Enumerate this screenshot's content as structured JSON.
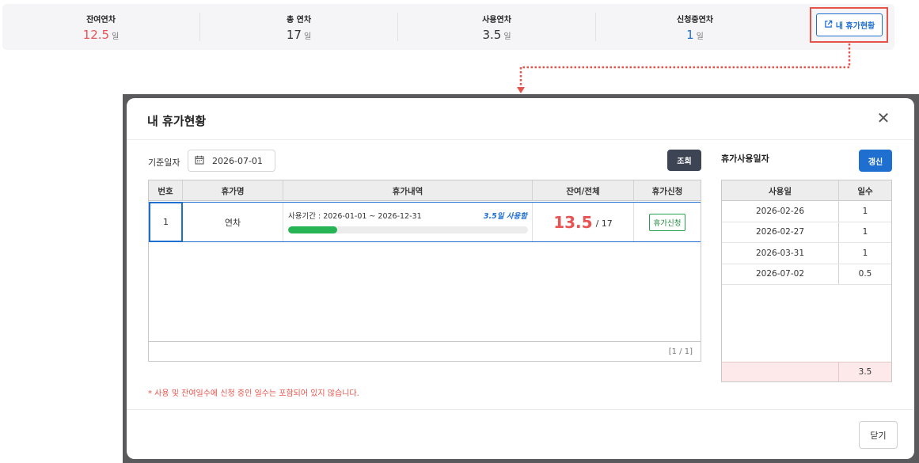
{
  "summary": {
    "remaining": {
      "label": "잔여연차",
      "value": "12.5",
      "unit": "일"
    },
    "total": {
      "label": "총 연차",
      "value": "17",
      "unit": "일"
    },
    "used": {
      "label": "사용연차",
      "value": "3.5",
      "unit": "일"
    },
    "pending": {
      "label": "신청중연차",
      "value": "1",
      "unit": "일"
    },
    "my_leave_button": "내 휴가현황"
  },
  "colors": {
    "accent": "#1f6fd1",
    "highlight": "#e5534b",
    "remaining": "#e85454",
    "progress": "#27b455"
  },
  "modal": {
    "title": "내 휴가현황",
    "base_date_label": "기준일자",
    "base_date_value": "2026-07-01",
    "search_button": "조회",
    "table": {
      "headers": [
        "번호",
        "휴가명",
        "휴가내역",
        "잔여/전체",
        "휴가신청"
      ],
      "rows": [
        {
          "no": "1",
          "name": "연차",
          "period": "사용기간 : 2026-01-01 ~ 2026-12-31",
          "used_text": "3.5일 사용함",
          "used_fraction": 0.206,
          "remaining": "13.5",
          "total": "/ 17",
          "request_button": "휴가신청"
        }
      ],
      "pagination": "[1 / 1]"
    },
    "note": "* 사용 및 잔여일수에 신청 중인 일수는 포함되어 있지 않습니다.",
    "usage": {
      "title": "휴가사용일자",
      "refresh_button": "갱신",
      "headers": [
        "사용일",
        "일수"
      ],
      "rows": [
        {
          "date": "2026-02-26",
          "days": "1"
        },
        {
          "date": "2026-02-27",
          "days": "1"
        },
        {
          "date": "2026-03-31",
          "days": "1"
        },
        {
          "date": "2026-07-02",
          "days": "0.5"
        }
      ],
      "total": "3.5"
    },
    "close_button": "닫기"
  }
}
